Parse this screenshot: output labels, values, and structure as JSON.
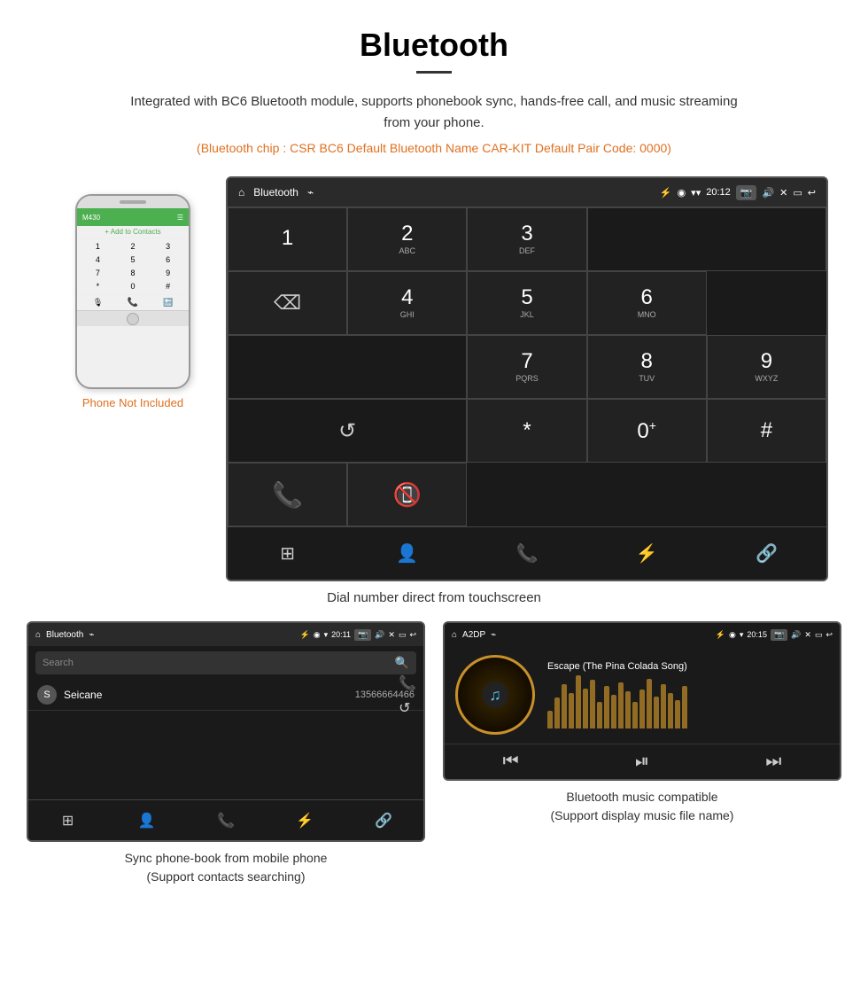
{
  "page": {
    "title": "Bluetooth",
    "description": "Integrated with BC6 Bluetooth module, supports phonebook sync, hands-free call, and music streaming from your phone.",
    "specs": "(Bluetooth chip : CSR BC6    Default Bluetooth Name CAR-KIT    Default Pair Code: 0000)",
    "phone_not_included": "Phone Not Included",
    "dial_caption": "Dial number direct from touchscreen",
    "phonebook_caption_line1": "Sync phone-book from mobile phone",
    "phonebook_caption_line2": "(Support contacts searching)",
    "music_caption_line1": "Bluetooth music compatible",
    "music_caption_line2": "(Support display music file name)"
  },
  "dial_screen": {
    "status_bar": {
      "title": "Bluetooth",
      "time": "20:12"
    },
    "keys": [
      {
        "num": "1",
        "sub": ""
      },
      {
        "num": "2",
        "sub": "ABC"
      },
      {
        "num": "3",
        "sub": "DEF"
      },
      {
        "num": "4",
        "sub": "GHI"
      },
      {
        "num": "5",
        "sub": "JKL"
      },
      {
        "num": "6",
        "sub": "MNO"
      },
      {
        "num": "7",
        "sub": "PQRS"
      },
      {
        "num": "8",
        "sub": "TUV"
      },
      {
        "num": "9",
        "sub": "WXYZ"
      },
      {
        "num": "*",
        "sub": ""
      },
      {
        "num": "0",
        "sub": "+"
      },
      {
        "num": "#",
        "sub": ""
      }
    ]
  },
  "phonebook_screen": {
    "status_bar": {
      "title": "Bluetooth",
      "time": "20:11"
    },
    "search_placeholder": "Search",
    "contact": {
      "initial": "S",
      "name": "Seicane",
      "number": "13566664466"
    }
  },
  "music_screen": {
    "status_bar": {
      "title": "A2DP",
      "time": "20:15"
    },
    "song_title": "Escape (The Pina Colada Song)",
    "eq_bars": [
      20,
      35,
      50,
      40,
      60,
      45,
      55,
      30,
      48,
      38,
      52,
      42,
      30,
      44,
      56,
      36,
      50,
      40,
      32,
      48
    ]
  }
}
